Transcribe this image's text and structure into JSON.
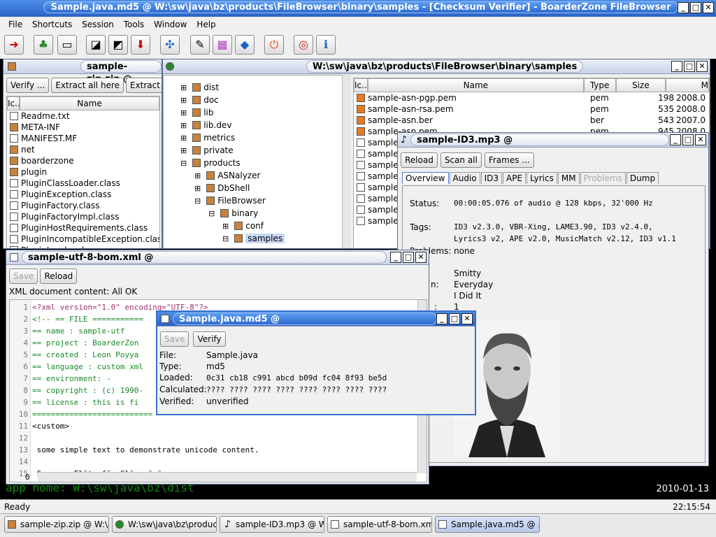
{
  "app": {
    "title": "Sample.java.md5 @ W:\\sw\\java\\bz\\products\\FileBrowser\\binary\\samples - [Checksum Verifier] - BoarderZone FileBrowser"
  },
  "menu": [
    "File",
    "Shortcuts",
    "Session",
    "Tools",
    "Window",
    "Help"
  ],
  "zip": {
    "title": "sample-zip.zip @",
    "buttons": [
      "Verify ...",
      "Extract all here",
      "Extract all to"
    ],
    "col_ic": "Ic...",
    "col_name": "Name",
    "rows": [
      "Readme.txt",
      "META-INF",
      "MANIFEST.MF",
      "net",
      "boarderzone",
      "plugin",
      "PluginClassLoader.class",
      "PluginException.class",
      "PluginFactory.class",
      "PluginFactoryImpl.class",
      "PluginHostRequirements.class",
      "PluginIncompatibleException.class",
      "PluginLoader.class"
    ]
  },
  "browser": {
    "title": "W:\\sw\\java\\bz\\products\\FileBrowser\\binary\\samples",
    "tree": [
      {
        "l": "dist",
        "d": 1
      },
      {
        "l": "doc",
        "d": 1
      },
      {
        "l": "lib",
        "d": 1
      },
      {
        "l": "lib.dev",
        "d": 1
      },
      {
        "l": "metrics",
        "d": 1
      },
      {
        "l": "private",
        "d": 1
      },
      {
        "l": "products",
        "d": 1
      },
      {
        "l": "ASNalyzer",
        "d": 2
      },
      {
        "l": "DbShell",
        "d": 2
      },
      {
        "l": "FileBrowser",
        "d": 2
      },
      {
        "l": "binary",
        "d": 3
      },
      {
        "l": "conf",
        "d": 4
      },
      {
        "l": "samples",
        "d": 4
      }
    ],
    "cols": {
      "ic": "Ic...",
      "name": "Name",
      "type": "Type",
      "size": "Size",
      "mod": "M"
    },
    "files": [
      {
        "n": "sample-asn-pgp.pem",
        "t": "pem",
        "s": "198",
        "m": "2008.0"
      },
      {
        "n": "sample-asn-rsa.pem",
        "t": "pem",
        "s": "535",
        "m": "2008.0"
      },
      {
        "n": "sample-asn.ber",
        "t": "ber",
        "s": "543",
        "m": "2007.0"
      },
      {
        "n": "sample-asn.pem",
        "t": "pem",
        "s": "945",
        "m": "2008.0"
      }
    ],
    "stub": "sample"
  },
  "id3": {
    "title": "sample-ID3.mp3 @ W:\\sw\\java\\bz\\products\\FileBrowse...",
    "buttons": [
      "Reload",
      "Scan all",
      "Frames ..."
    ],
    "tabs": [
      "Overview",
      "Audio",
      "ID3",
      "APE",
      "Lyrics",
      "MM",
      "Problems",
      "Dump"
    ],
    "status_label": "Status:",
    "status_value": "00:00:05.076 of audio @ 128 kbps, 32'000 Hz",
    "tags_label": "Tags:",
    "tags_value1": "ID3 v2.3.0, VBR-Xing, LAME3.90, ID3 v2.4.0,",
    "tags_value2": "Lyrics3 v2, APE v2.0, MusicMatch v2.12, ID3 v1.1",
    "problems_label": "Problems:",
    "problems_value": "none",
    "f1": "Smitty",
    "f2_label": "n:",
    "f2": "Everyday",
    "f3": "I Did It",
    "f4_label": ":",
    "f4": "1"
  },
  "xml": {
    "title": "sample-utf-8-bom.xml @ W:\\sw\\java\\bz\\products\\FileBrowser\\binary\\samples -...",
    "save": "Save",
    "reload": "Reload",
    "status": "XML document content:  All OK",
    "lines": [
      "<?xml version=\"1.0\" encoding=\"UTF-8\"?>",
      "<!-- == FILE ===========",
      "== name       : sample-utf",
      "== project    : BoarderZon",
      "== created    : Leon Poyya",
      "== language   : custom xml",
      "== environment: -",
      "== copyright  : (c) 1990-",
      "== license    : this is fi",
      "==========================",
      "<custom>",
      "",
      "  some simple text to demonstrate unicode content.",
      "",
      "  Some... Flütz für Glöm  nä ö"
    ],
    "gutter_bottom": "0"
  },
  "md5": {
    "title": "Sample.java.md5 @ W:\\sw\\java\\bz\\products\\FileBrows...",
    "save": "Save",
    "verify": "Verify",
    "file_label": "File:",
    "file": "Sample.java",
    "type_label": "Type:",
    "type": "md5",
    "loaded_label": "Loaded:",
    "loaded": "0c31 cb18 c991 abcd b09d fc04 8f93 be5d",
    "calc_label": "Calculated:",
    "calc": "???? ???? ???? ???? ???? ???? ???? ????",
    "ver_label": "Verified:",
    "ver": "unverified"
  },
  "console": {
    "text": "app home: W:\\sw\\java\\bz\\dist",
    "date": "2010-01-13"
  },
  "status": {
    "text": "Ready",
    "time": "22:15:54"
  },
  "taskbar": [
    "sample-zip.zip @ W:\\s...",
    "W:\\sw\\java\\bz\\product...",
    "sample-ID3.mp3 @ W:...",
    "sample-utf-8-bom.xml...",
    "Sample.java.md5 @ ..."
  ]
}
